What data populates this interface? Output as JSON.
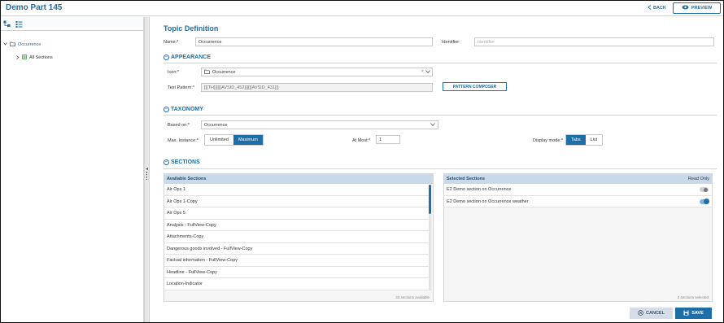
{
  "header": {
    "app_title": "Demo Part 145",
    "back_label": "BACK",
    "preview_label": "PREVIEW"
  },
  "tree": {
    "root_label": "Occurrence",
    "child_label": "All Sections"
  },
  "form": {
    "title": "Topic Definition",
    "name_label": "Name:*",
    "name_value": "Occurrence",
    "identifier_label": "Identifier:",
    "identifier_placeholder": "Identifier"
  },
  "appearance": {
    "heading": "APPEARANCE",
    "icon_label": "Icon:*",
    "icon_value": "Occurrence",
    "text_pattern_label": "Text Pattern:*",
    "text_pattern_value": "[[[TH]]][[[AVSID_452]]][[[AVSID_431]]]",
    "pattern_composer_label": "PATTERN COMPOSER"
  },
  "taxonomy": {
    "heading": "TAXONOMY",
    "based_on_label": "Based on:*",
    "based_on_value": "Occurrence",
    "max_instance_label": "Max. Instance:*",
    "max_instance_options": [
      "Unlimited",
      "Maximum"
    ],
    "max_instance_selected": "Maximum",
    "at_most_label": "At Most:*",
    "at_most_value": "1",
    "display_mode_label": "Display mode:*",
    "display_mode_options": [
      "Tabs",
      "List"
    ],
    "display_mode_selected": "Tabs"
  },
  "sections": {
    "heading": "SECTIONS",
    "available_title": "Available Sections",
    "available_items": [
      "Air Ops 1",
      "Air Ops 1-Copy",
      "Air Ops 5",
      "Analysis - FullView-Copy",
      "Attachments-Copy",
      "Dangerous goods involved - FullView-Copy",
      "Factual information - FullView-Copy",
      "Headline - FullView-Copy",
      "Location-Indicator"
    ],
    "available_footer": "33 sections available",
    "selected_title": "Selected Sections",
    "selected_readonly_label": "Read Only",
    "selected_items": [
      {
        "label": "E2 Demo section on Occurrence",
        "toggle": "off"
      },
      {
        "label": "E2 Demo section on Occurrence weather",
        "toggle": "on"
      }
    ],
    "selected_footer": "2 sections selected"
  },
  "actions": {
    "cancel_label": "CANCEL",
    "save_label": "SAVE"
  },
  "colors": {
    "accent": "#1e6fa8",
    "panel_header": "#c7d9ea"
  }
}
